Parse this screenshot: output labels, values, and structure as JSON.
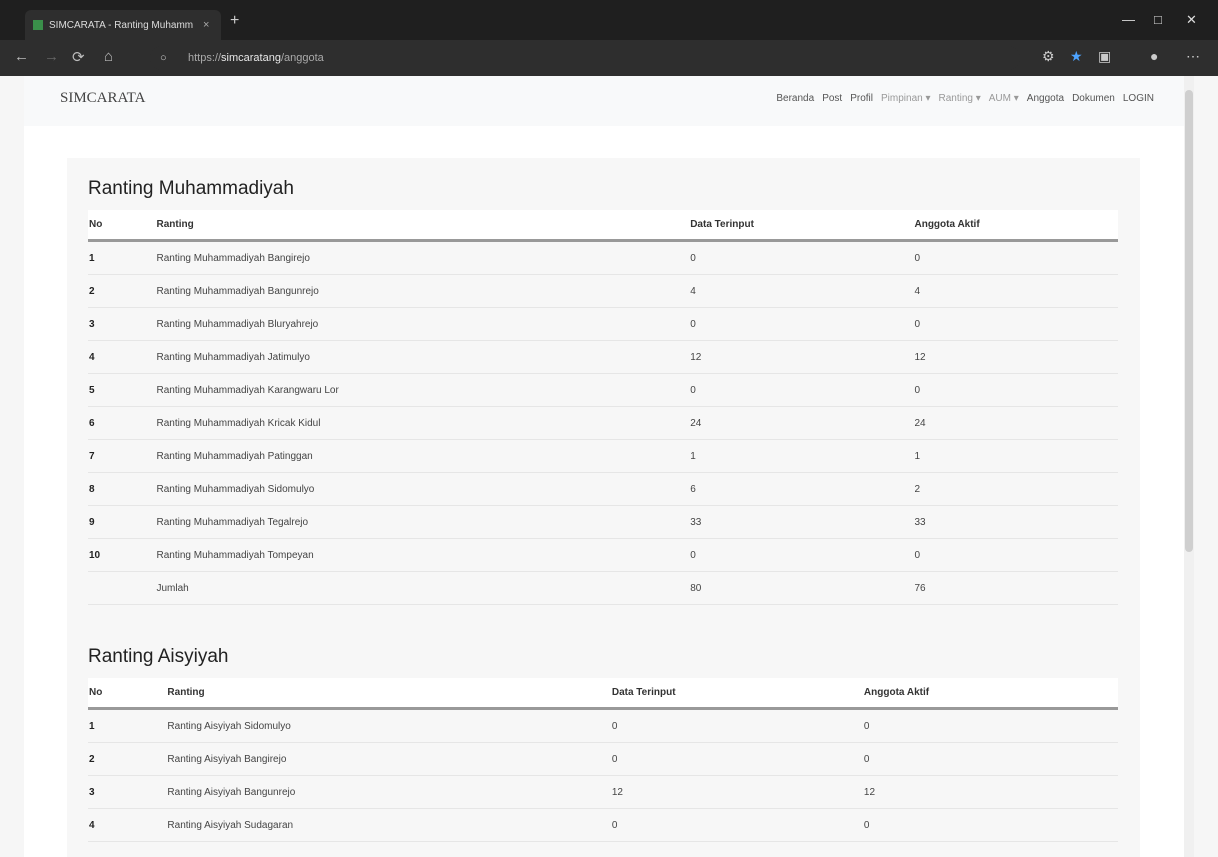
{
  "browser": {
    "tab_title": "SIMCARATA - Ranting Muhamm",
    "tab_close": "×",
    "new_tab": "+",
    "url_prefix": "https://",
    "url_host": "simcaratang",
    "url_path": "/anggota"
  },
  "site": {
    "brand": "SIMCARATA",
    "nav": [
      {
        "label": "Beranda",
        "muted": false
      },
      {
        "label": "Post",
        "muted": false
      },
      {
        "label": "Profil",
        "muted": false
      },
      {
        "label": "Pimpinan ▾",
        "muted": true
      },
      {
        "label": "Ranting ▾",
        "muted": true
      },
      {
        "label": "AUM ▾",
        "muted": true
      },
      {
        "label": "Anggota",
        "muted": false
      },
      {
        "label": "Dokumen",
        "muted": false
      },
      {
        "label": "LOGIN",
        "muted": false
      }
    ]
  },
  "muhammadiyah": {
    "title": "Ranting Muhammadiyah",
    "headers": [
      "No",
      "Ranting",
      "Data Terinput",
      "Anggota Aktif"
    ],
    "rows": [
      [
        "1",
        "Ranting Muhammadiyah Bangirejo",
        "0",
        "0"
      ],
      [
        "2",
        "Ranting Muhammadiyah Bangunrejo",
        "4",
        "4"
      ],
      [
        "3",
        "Ranting Muhammadiyah Bluryahrejo",
        "0",
        "0"
      ],
      [
        "4",
        "Ranting Muhammadiyah Jatimulyo",
        "12",
        "12"
      ],
      [
        "5",
        "Ranting Muhammadiyah Karangwaru Lor",
        "0",
        "0"
      ],
      [
        "6",
        "Ranting Muhammadiyah Kricak Kidul",
        "24",
        "24"
      ],
      [
        "7",
        "Ranting Muhammadiyah Patinggan",
        "1",
        "1"
      ],
      [
        "8",
        "Ranting Muhammadiyah Sidomulyo",
        "6",
        "2"
      ],
      [
        "9",
        "Ranting Muhammadiyah Tegalrejo",
        "33",
        "33"
      ],
      [
        "10",
        "Ranting Muhammadiyah Tompeyan",
        "0",
        "0"
      ]
    ],
    "total": [
      "",
      "Jumlah",
      "80",
      "76"
    ]
  },
  "aisyiyah": {
    "title": "Ranting Aisyiyah",
    "headers": [
      "No",
      "Ranting",
      "Data Terinput",
      "Anggota Aktif"
    ],
    "rows": [
      [
        "1",
        "Ranting Aisyiyah Sidomulyo",
        "0",
        "0"
      ],
      [
        "2",
        "Ranting Aisyiyah Bangirejo",
        "0",
        "0"
      ],
      [
        "3",
        "Ranting Aisyiyah Bangunrejo",
        "12",
        "12"
      ],
      [
        "4",
        "Ranting Aisyiyah Sudagaran",
        "0",
        "0"
      ]
    ]
  },
  "icons": [
    "back-icon",
    "forward-icon",
    "reload-icon",
    "home-icon",
    "lock-icon",
    "extensions-icon",
    "bookmark-icon",
    "profile-icon",
    "menu-icon"
  ]
}
